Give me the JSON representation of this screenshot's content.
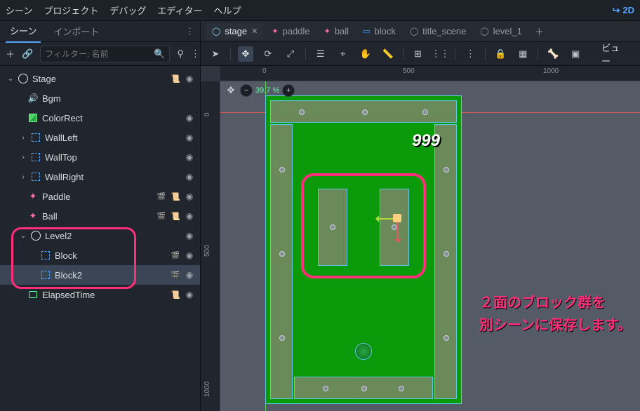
{
  "menu": {
    "scene": "シーン",
    "project": "プロジェクト",
    "debug": "デバッグ",
    "editor": "エディター",
    "help": "ヘルプ",
    "mode2d": "2D"
  },
  "panel": {
    "tabs": {
      "scene": "シーン",
      "import": "インポート"
    },
    "filter_placeholder": "フィルター: 名前"
  },
  "tree": {
    "stage": "Stage",
    "bgm": "Bgm",
    "colorrect": "ColorRect",
    "wallleft": "WallLeft",
    "walltop": "WallTop",
    "wallright": "WallRight",
    "paddle": "Paddle",
    "ball": "Ball",
    "level2": "Level2",
    "block": "Block",
    "block2": "Block2",
    "elapsed": "ElapsedTime"
  },
  "filetabs": {
    "stage": "stage",
    "paddle": "paddle",
    "ball": "ball",
    "block": "block",
    "title_scene": "title_scene",
    "level1": "level_1"
  },
  "viewport": {
    "view_btn": "ビュー",
    "zoom": "39.7 %",
    "score": "999",
    "ruler_h": [
      "0",
      "500",
      "1000"
    ],
    "ruler_v": [
      "0",
      "500",
      "1000"
    ]
  },
  "annotation": {
    "line1": "２面のブロック群を",
    "line2": "別シーンに保存します。"
  }
}
